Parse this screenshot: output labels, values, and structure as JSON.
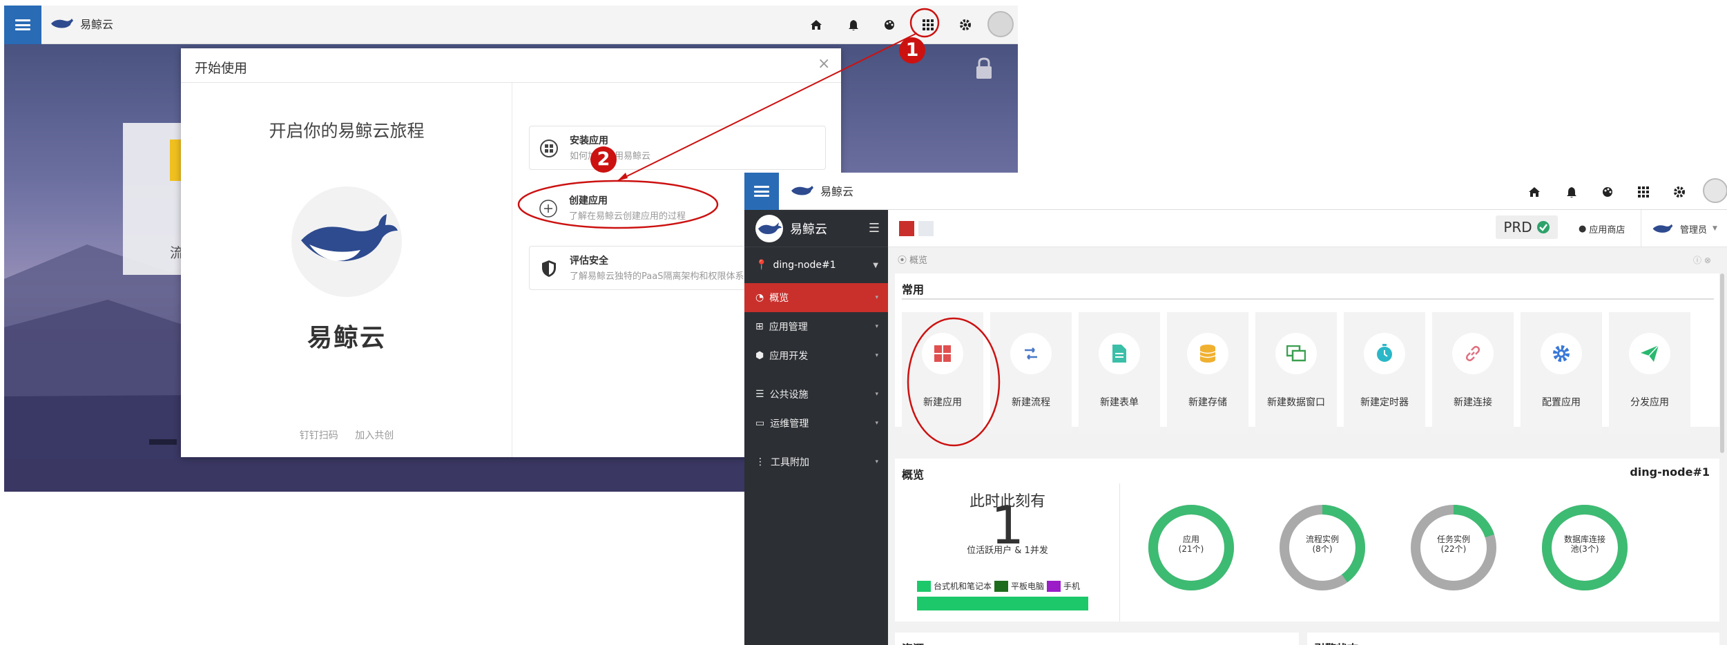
{
  "left_window": {
    "app_name": "易鲸云",
    "card_text": "流",
    "dialog": {
      "title": "开始使用",
      "close": "×",
      "heading": "开启你的易鲸云旅程",
      "brand": "易鲸云",
      "footer": [
        "钉钉扫码",
        "加入共创"
      ],
      "options": [
        {
          "title": "安装应用",
          "desc": "如何加入使用易鲸云",
          "icon": "grid-icon"
        },
        {
          "title": "创建应用",
          "desc": "了解在易鲸云创建应用的过程",
          "icon": "plus-circle-icon"
        },
        {
          "title": "评估安全",
          "desc": "了解易鲸云独特的PaaS隔离架构和权限体系",
          "icon": "shield-icon"
        }
      ]
    }
  },
  "annotations": {
    "step1": "1",
    "step2": "2",
    "annotation_color": "#cc1111"
  },
  "right_window": {
    "app_name": "易鲸云",
    "sidebar": {
      "brand": "易鲸云",
      "node": "ding-node#1",
      "items": [
        {
          "label": "概览",
          "icon": "dashboard-icon",
          "active": true
        },
        {
          "label": "应用管理",
          "icon": "apps-icon"
        },
        {
          "label": "应用开发",
          "icon": "cube-icon"
        },
        {
          "label": "公共设施",
          "icon": "server-icon"
        },
        {
          "label": "运维管理",
          "icon": "monitor-icon"
        },
        {
          "label": "工具附加",
          "icon": "more-vertical-icon"
        }
      ]
    },
    "header": {
      "env": "PRD",
      "store": "应用商店",
      "user": "管理员"
    },
    "breadcrumb": "概览",
    "common": {
      "title": "常用",
      "tiles": [
        {
          "label": "新建应用",
          "icon": "grid-icon",
          "color": "#e05050"
        },
        {
          "label": "新建流程",
          "icon": "flow-icon",
          "color": "#4a78c8"
        },
        {
          "label": "新建表单",
          "icon": "form-icon",
          "color": "#3cbfa8"
        },
        {
          "label": "新建存储",
          "icon": "database-icon",
          "color": "#f0b030"
        },
        {
          "label": "新建数据窗口",
          "icon": "window-icon",
          "color": "#3aa050"
        },
        {
          "label": "新建定时器",
          "icon": "timer-icon",
          "color": "#2ab8c8"
        },
        {
          "label": "新建连接",
          "icon": "link-icon",
          "color": "#e07080"
        },
        {
          "label": "配置应用",
          "icon": "gear-icon",
          "color": "#3a78d8"
        },
        {
          "label": "分发应用",
          "icon": "send-icon",
          "color": "#2ab870"
        }
      ]
    },
    "overview": {
      "title": "概览",
      "node": "ding-node#1",
      "now": "此时此刻有",
      "count": "1",
      "online": "位活跃用户 & 1并发",
      "legend": [
        {
          "label": "台式机和笔记本",
          "color": "#1dc86a"
        },
        {
          "label": "平板电脑",
          "color": "#1d6b1d"
        },
        {
          "label": "手机",
          "color": "#9b1dc8"
        }
      ],
      "donuts": [
        {
          "line1": "应用",
          "line2": "(21个)",
          "fraction": 1.0,
          "color": "#3dbb73"
        },
        {
          "line1": "流程实例",
          "line2": "(8个)",
          "fraction": 0.4,
          "color": "#3dbb73"
        },
        {
          "line1": "任务实例",
          "line2": "(22个)",
          "fraction": 0.2,
          "color": "#3dbb73"
        },
        {
          "line1": "数据库连接",
          "line2": "池(3个)",
          "fraction": 1.0,
          "color": "#3dbb73"
        }
      ]
    },
    "bottom": [
      "资源",
      "引擎状态"
    ]
  }
}
